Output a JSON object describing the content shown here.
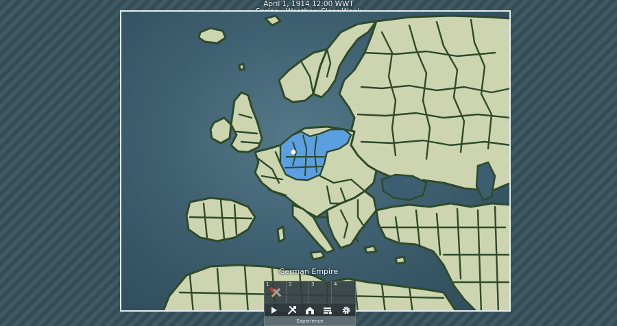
{
  "header": {
    "date_line": "April 1, 1914 12:00 WWT",
    "weather_line": "Spring · Weather: Clear Week"
  },
  "map": {
    "selected_nation": "German Empire",
    "land_color": "#cdd5b0",
    "sea_color": "#3f6070",
    "border_color": "#2d4a2a",
    "player_color": "#5b9fe0"
  },
  "hotbar": {
    "slots": [
      {
        "number": "1",
        "icon": "hammer-icon"
      },
      {
        "number": "2",
        "icon": ""
      },
      {
        "number": "3",
        "icon": ""
      },
      {
        "number": "4",
        "icon": ""
      }
    ]
  },
  "toolbar": {
    "buttons": [
      {
        "name": "play-button",
        "icon": "play-icon"
      },
      {
        "name": "build-tools-button",
        "icon": "tools-icon"
      },
      {
        "name": "buildings-button",
        "icon": "building-icon"
      },
      {
        "name": "diplomacy-button",
        "icon": "flag-icon"
      },
      {
        "name": "settings-button",
        "icon": "gear-icon"
      }
    ]
  },
  "experience": {
    "label": "Experience",
    "progress": 0.0
  }
}
